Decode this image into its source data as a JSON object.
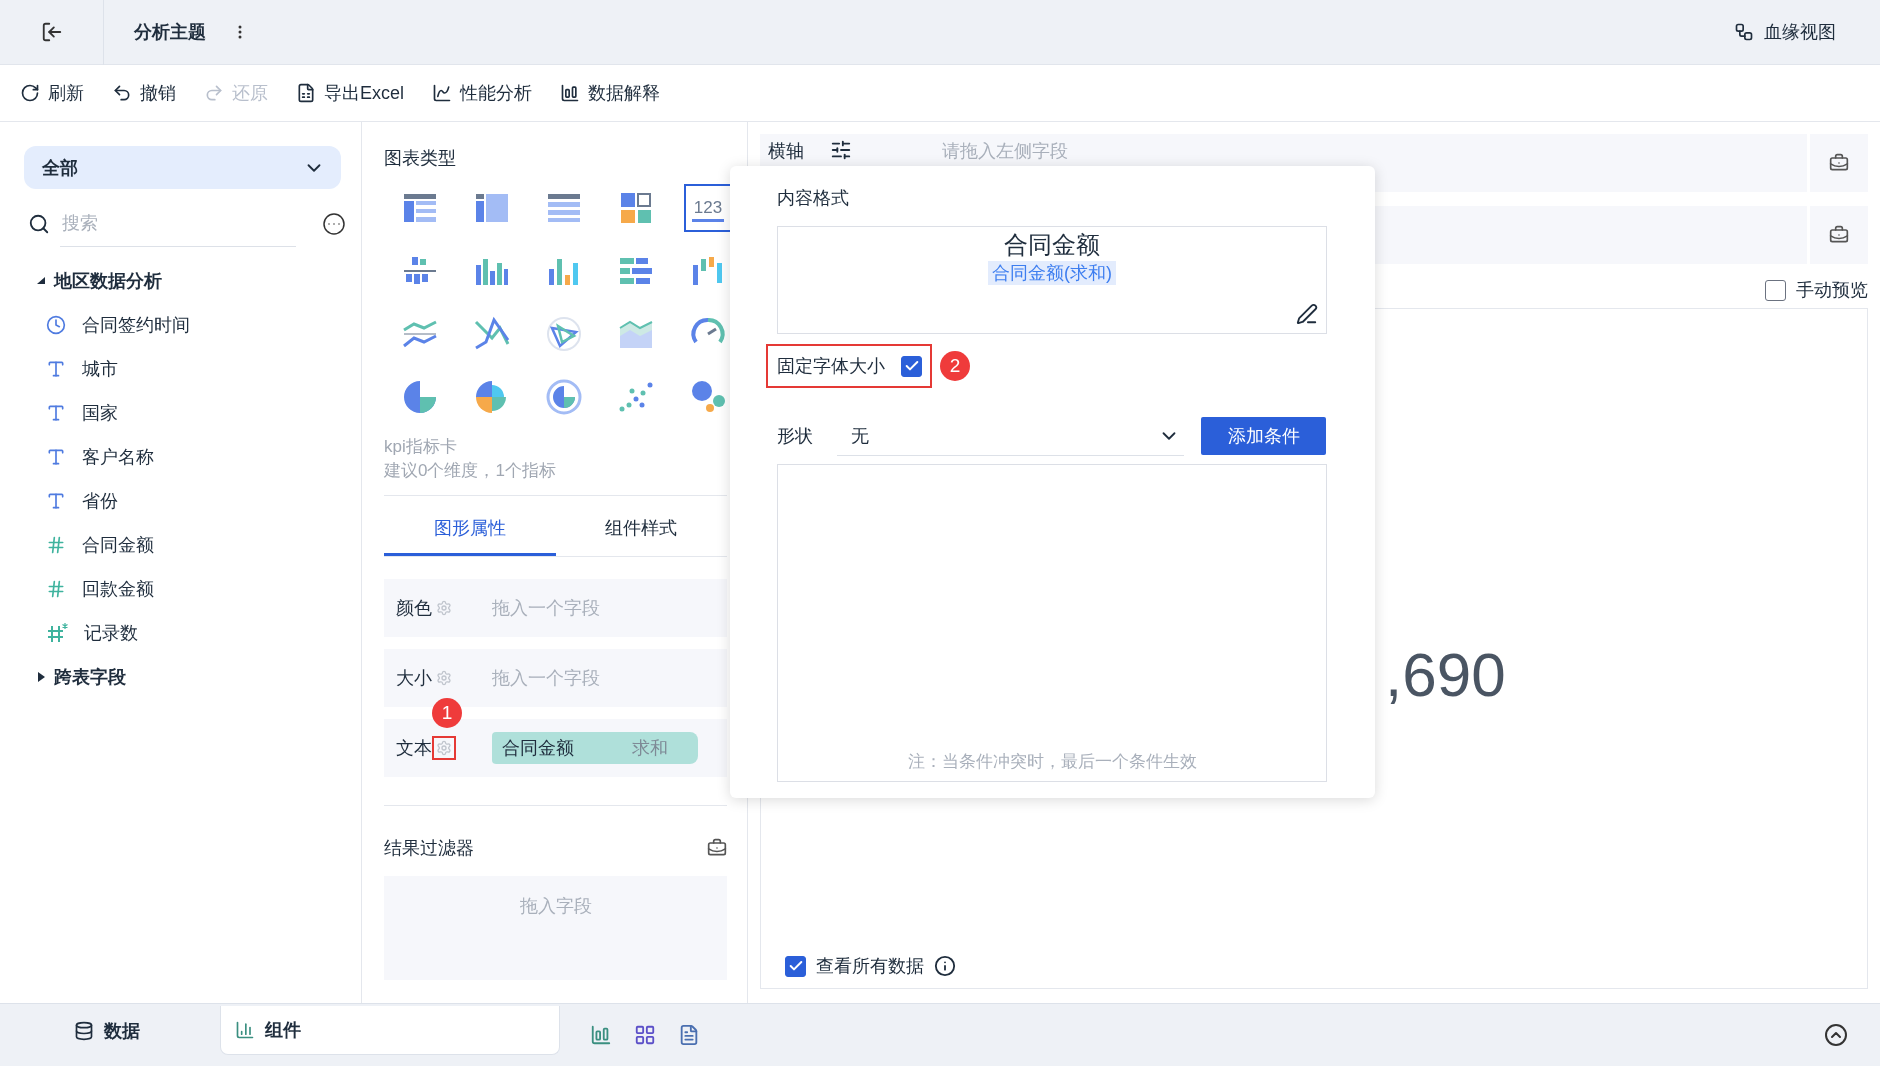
{
  "header": {
    "title": "分析主题",
    "lineage": "血缘视图"
  },
  "toolbar": [
    {
      "label": "刷新",
      "kind": "refresh",
      "disabled": false
    },
    {
      "label": "撤销",
      "kind": "undo",
      "disabled": false
    },
    {
      "label": "还原",
      "kind": "redo",
      "disabled": true
    },
    {
      "label": "导出Excel",
      "kind": "excel",
      "disabled": false
    },
    {
      "label": "性能分析",
      "kind": "perf",
      "disabled": false
    },
    {
      "label": "数据解释",
      "kind": "explain",
      "disabled": false
    }
  ],
  "fields_panel": {
    "scope": "全部",
    "search_placeholder": "搜索",
    "tree": [
      {
        "label": "地区数据分析",
        "expanded": true,
        "children": [
          {
            "label": "合同签约时间",
            "kind": "date"
          },
          {
            "label": "城市",
            "kind": "text"
          },
          {
            "label": "国家",
            "kind": "text"
          },
          {
            "label": "客户名称",
            "kind": "text"
          },
          {
            "label": "省份",
            "kind": "text"
          },
          {
            "label": "合同金额",
            "kind": "number"
          },
          {
            "label": "回款金额",
            "kind": "number"
          },
          {
            "label": "记录数",
            "kind": "calc"
          }
        ]
      },
      {
        "label": "跨表字段",
        "expanded": false
      }
    ]
  },
  "chart_panel": {
    "title": "图表类型",
    "chart_types": [
      {
        "kind": "table",
        "selected": false
      },
      {
        "kind": "pivot",
        "selected": false
      },
      {
        "kind": "detail",
        "selected": false
      },
      {
        "kind": "treemap",
        "selected": false
      },
      {
        "kind": "kpi",
        "label": "123",
        "selected": true
      },
      {
        "kind": "hbars",
        "selected": false
      },
      {
        "kind": "stacked",
        "selected": false
      },
      {
        "kind": "columns",
        "selected": false
      },
      {
        "kind": "barrows",
        "selected": false
      },
      {
        "kind": "waterfall",
        "selected": false
      },
      {
        "kind": "lines",
        "selected": false
      },
      {
        "kind": "cross",
        "selected": false
      },
      {
        "kind": "radar",
        "selected": false
      },
      {
        "kind": "area",
        "selected": false
      },
      {
        "kind": "gauge",
        "selected": false
      },
      {
        "kind": "pie",
        "selected": false
      },
      {
        "kind": "rose",
        "selected": false
      },
      {
        "kind": "donut",
        "selected": false
      },
      {
        "kind": "scatter",
        "selected": false
      },
      {
        "kind": "bubble",
        "selected": false
      }
    ],
    "hint_name": "kpi指标卡",
    "hint_text": "建议0个维度，1个指标",
    "tabs": [
      {
        "label": "图形属性",
        "selected": true
      },
      {
        "label": "组件样式",
        "selected": false
      }
    ],
    "properties": [
      {
        "label": "颜色",
        "placeholder": "拖入一个字段"
      },
      {
        "label": "大小",
        "placeholder": "拖入一个字段"
      },
      {
        "label": "文本",
        "field": "合同金额",
        "aggregation": "求和",
        "callout": "1"
      }
    ],
    "filter": {
      "title": "结果过滤器",
      "placeholder": "拖入字段"
    }
  },
  "popup": {
    "title": "内容格式",
    "preview_title": "合同金额",
    "preview_token": "合同金额(求和)",
    "fixed_font": {
      "label": "固定字体大小",
      "checked": true,
      "callout": "2"
    },
    "shape": {
      "label": "形状",
      "value": "无"
    },
    "add_button": "添加条件",
    "note": "注：当条件冲突时，最后一个条件生效"
  },
  "canvas": {
    "axis_rows": [
      {
        "kind": "labeled",
        "label": "横轴",
        "placeholder": "请拖入左侧字段"
      },
      {
        "kind": "covered"
      }
    ],
    "manual_preview": {
      "label": "手动预览",
      "checked": false
    },
    "kpi_value": ",690",
    "view_all": {
      "label": "查看所有数据",
      "checked": true
    }
  },
  "bottom_bar": {
    "tabs": [
      {
        "label": "数据",
        "kind": "data",
        "selected": false
      },
      {
        "label": "组件",
        "kind": "component",
        "selected": true
      }
    ]
  }
}
